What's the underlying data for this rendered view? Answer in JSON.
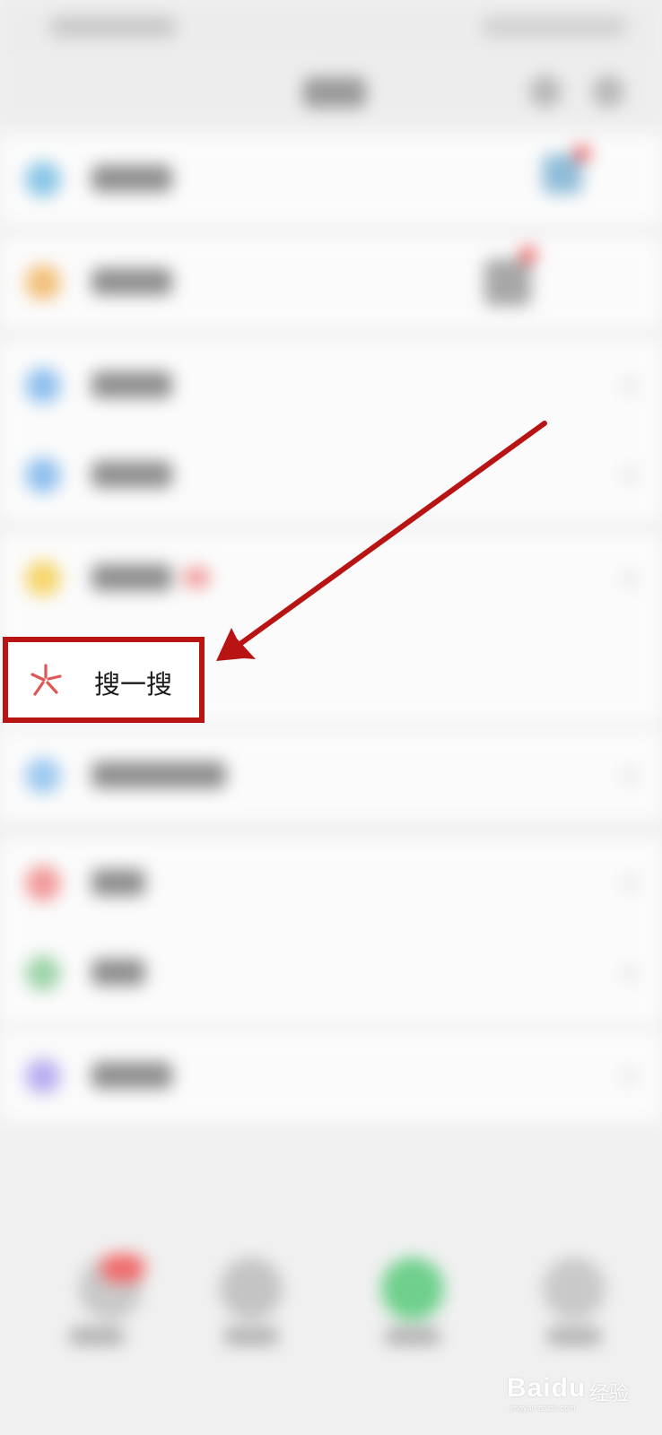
{
  "highlighted_item": {
    "label": "搜一搜",
    "icon": "sparkle-icon",
    "icon_color": "#e05555"
  },
  "annotation": {
    "box_color": "#b81414",
    "arrow_color": "#b81414"
  },
  "blurred_menu_icons": [
    {
      "icon": "moments-icon",
      "color": "#8ac6e8"
    },
    {
      "icon": "channels-icon",
      "color": "#f3c07a"
    },
    {
      "icon": "scan-icon",
      "color": "#8fc0ef"
    },
    {
      "icon": "shake-icon",
      "color": "#8fc0ef"
    },
    {
      "icon": "top-stories-icon",
      "color": "#f6d56b"
    },
    {
      "icon": "nearby-icon",
      "color": "#9cc9f0"
    },
    {
      "icon": "shopping-icon",
      "color": "#f19a9a"
    },
    {
      "icon": "games-icon",
      "color": "#9fd4a9"
    },
    {
      "icon": "mini-programs-icon",
      "color": "#b8aef0"
    }
  ],
  "watermark": {
    "brand": "Baidu",
    "sub": "经验",
    "url": "jingyan.baidu.com"
  }
}
